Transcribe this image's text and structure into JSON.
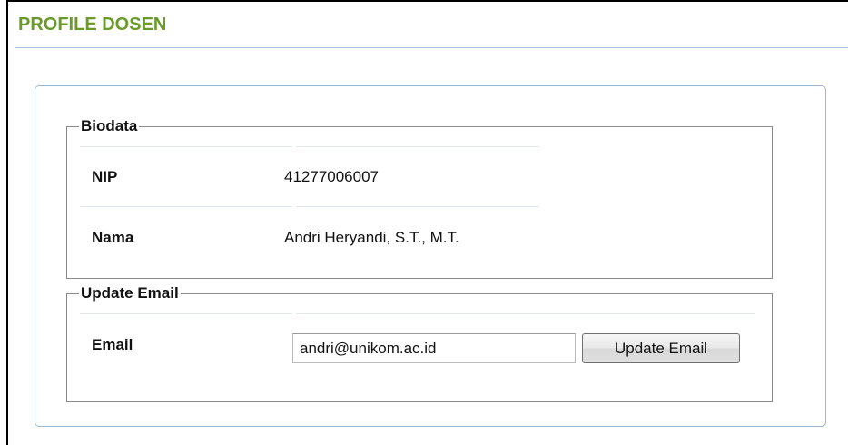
{
  "page": {
    "title": "PROFILE DOSEN"
  },
  "biodata": {
    "legend": "Biodata",
    "rows": [
      {
        "label": "NIP",
        "value": "41277006007"
      },
      {
        "label": "Nama",
        "value": "Andri Heryandi, S.T., M.T."
      }
    ]
  },
  "update_email": {
    "legend": "Update Email",
    "label": "Email",
    "input_value": "andri@unikom.ac.id",
    "button_label": "Update Email"
  },
  "colors": {
    "title": "#6a9a2a",
    "panel_border": "#9db6d2",
    "fieldset_border": "#8a8a8a"
  }
}
